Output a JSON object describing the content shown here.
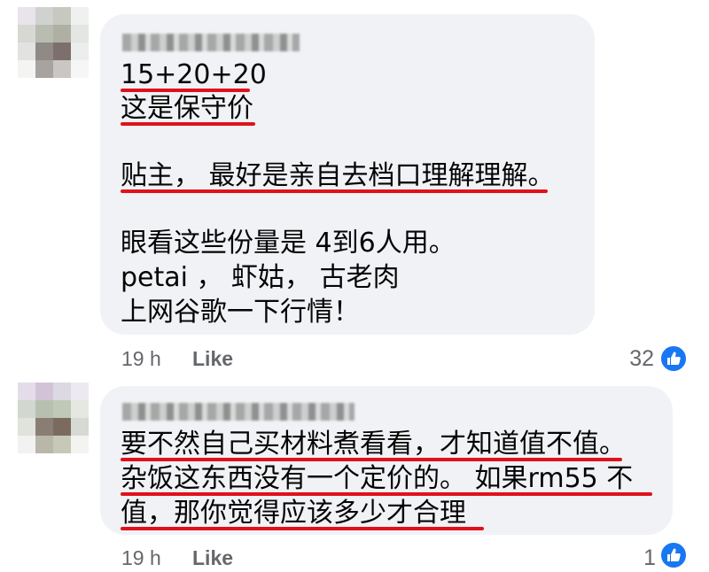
{
  "comments": [
    {
      "lines": [
        "15+20+20",
        "这是保守价",
        "贴主， 最好是亲自去档口理解理解。",
        "眼看这些份量是 4到6人用。",
        "petai ， 虾姑， 古老肉",
        "上网谷歌一下行情！"
      ],
      "time": "19 h",
      "like_label": "Like",
      "reaction_count": "32"
    },
    {
      "lines": [
        "要不然自己买材料煮看看，才知道值不值。",
        "杂饭这东西没有一个定价的。 如果rm55 不",
        "值，那你觉得应该多少才合理"
      ],
      "time": "19 h",
      "like_label": "Like",
      "reaction_count": "1"
    }
  ],
  "icons": {
    "avatar": "blurred-avatar",
    "reaction": "thumbs-up-icon"
  },
  "colors": {
    "bubble": "#f0f2f5",
    "underline": "#e0111b",
    "meta_text": "#65676b",
    "like_blue": "#1877f2"
  }
}
